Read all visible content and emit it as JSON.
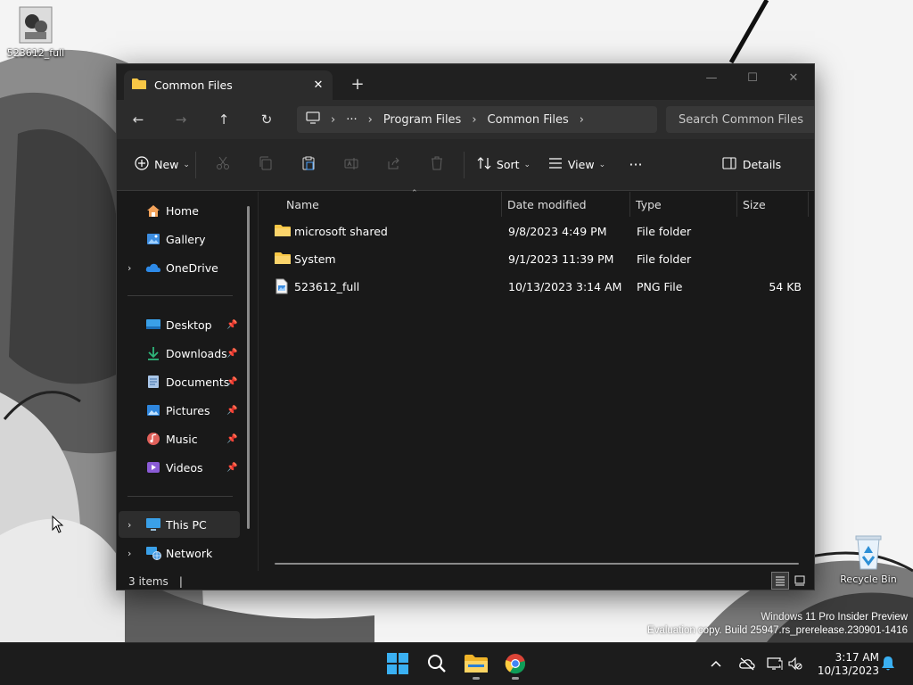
{
  "desktop": {
    "icons": [
      {
        "label": "523612_full"
      },
      {
        "label": "Recycle Bin"
      }
    ],
    "watermark": {
      "line1": "Windows 11 Pro Insider Preview",
      "line2": "Evaluation copy. Build 25947.rs_prerelease.230901-1416"
    }
  },
  "window": {
    "tab_title": "Common Files",
    "new_tab_label": "+",
    "caption": {
      "minimize": "—",
      "maximize": "☐",
      "close": "✕"
    },
    "nav": {
      "back": "←",
      "forward": "→",
      "up": "↑",
      "refresh": "↻"
    },
    "address": {
      "overflow": "···",
      "crumbs": [
        "Program Files",
        "Common Files"
      ],
      "separator": "›"
    },
    "search_placeholder": "Search Common Files",
    "toolbar": {
      "new_label": "New",
      "sort_label": "Sort",
      "view_label": "View",
      "more_label": "···",
      "details_label": "Details",
      "chevron": "⌄"
    },
    "sidebar": {
      "top": [
        {
          "label": "Home"
        },
        {
          "label": "Gallery"
        },
        {
          "label": "OneDrive"
        }
      ],
      "quick": [
        {
          "label": "Desktop"
        },
        {
          "label": "Downloads"
        },
        {
          "label": "Documents"
        },
        {
          "label": "Pictures"
        },
        {
          "label": "Music"
        },
        {
          "label": "Videos"
        }
      ],
      "bottom": [
        {
          "label": "This PC"
        },
        {
          "label": "Network"
        }
      ],
      "pin_glyph": "📌",
      "expander_glyph": "›"
    },
    "columns": {
      "name": "Name",
      "date": "Date modified",
      "type": "Type",
      "size": "Size"
    },
    "files": [
      {
        "name": "microsoft shared",
        "date": "9/8/2023 4:49 PM",
        "type": "File folder",
        "size": "",
        "kind": "folder"
      },
      {
        "name": "System",
        "date": "9/1/2023 11:39 PM",
        "type": "File folder",
        "size": "",
        "kind": "folder"
      },
      {
        "name": "523612_full",
        "date": "10/13/2023 3:14 AM",
        "type": "PNG File",
        "size": "54 KB",
        "kind": "png"
      }
    ],
    "status": {
      "count": "3 items",
      "caret": "|"
    }
  },
  "taskbar": {
    "clock_time": "3:17 AM",
    "clock_date": "10/13/2023",
    "tray_chevron": "^"
  },
  "colors": {
    "window_bg": "#191919",
    "accent_blue": "#0078d4",
    "folder_yellow": "#f8c746"
  }
}
